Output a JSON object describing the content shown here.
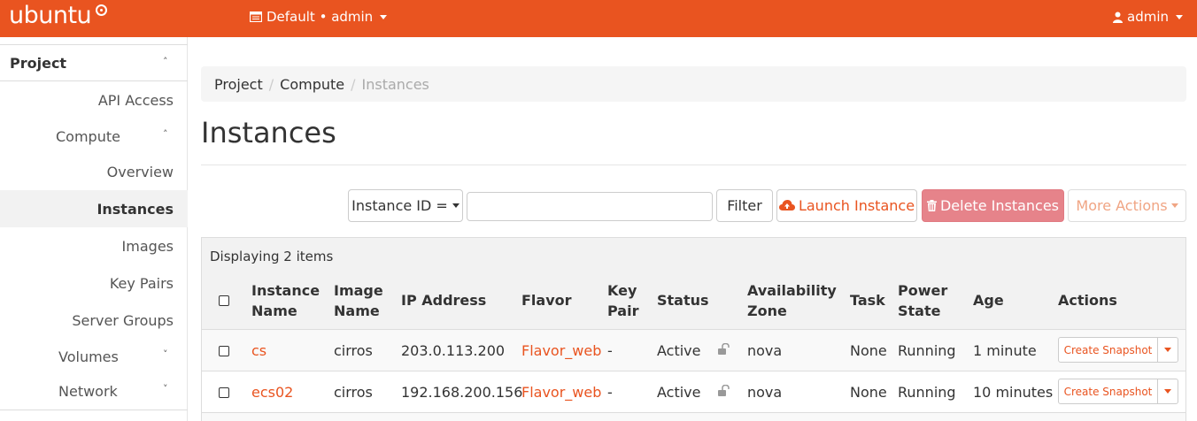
{
  "navbar": {
    "brand": "ubuntu",
    "project_switch": "Default • admin",
    "user": "admin",
    "colors": {
      "bar": "#e95420",
      "text": "#ffffff"
    }
  },
  "sidebar": {
    "project_label": "Project",
    "items": [
      {
        "label": "API Access"
      },
      {
        "label": "Compute"
      },
      {
        "label": "Overview"
      },
      {
        "label": "Instances"
      },
      {
        "label": "Images"
      },
      {
        "label": "Key Pairs"
      },
      {
        "label": "Server Groups"
      },
      {
        "label": "Volumes"
      },
      {
        "label": "Network"
      }
    ],
    "active": "Instances"
  },
  "breadcrumb": {
    "items": [
      "Project",
      "Compute"
    ],
    "current": "Instances"
  },
  "page": {
    "title": "Instances"
  },
  "toolbar": {
    "filter_field": "Instance ID =",
    "filter_input_value": "",
    "filter_button": "Filter",
    "launch_button": "Launch Instance",
    "delete_button": "Delete Instances",
    "more_actions": "More Actions"
  },
  "table": {
    "displaying": "Displaying 2 items",
    "headers": {
      "instance_name": [
        "Instance",
        "Name"
      ],
      "image_name": [
        "Image",
        "Name"
      ],
      "ip_address": "IP Address",
      "flavor": "Flavor",
      "key_pair": [
        "Key",
        "Pair"
      ],
      "status": "Status",
      "availability_zone": [
        "Availability",
        "Zone"
      ],
      "task": "Task",
      "power_state": [
        "Power",
        "State"
      ],
      "age": "Age",
      "actions": "Actions"
    },
    "rows": [
      {
        "name": "cs",
        "image": "cirros",
        "ip": "203.0.113.200",
        "flavor": "Flavor_web",
        "key_pair": "-",
        "status": "Active",
        "zone": "nova",
        "task": "None",
        "power": "Running",
        "age": "1 minute",
        "action": "Create Snapshot"
      },
      {
        "name": "ecs02",
        "image": "cirros",
        "ip": "192.168.200.156",
        "flavor": "Flavor_web",
        "key_pair": "-",
        "status": "Active",
        "zone": "nova",
        "task": "None",
        "power": "Running",
        "age": "10 minutes",
        "action": "Create Snapshot"
      }
    ]
  }
}
